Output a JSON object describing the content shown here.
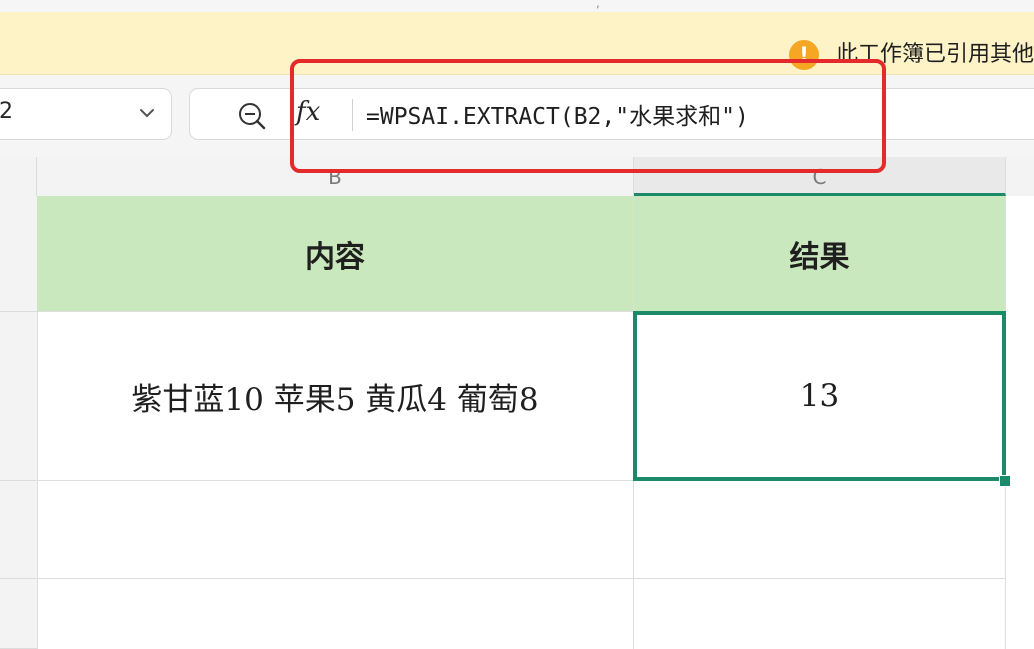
{
  "notice": {
    "icon": "warning-icon",
    "message": "此工作簿已引用其他"
  },
  "formula_bar": {
    "name_box": "2",
    "fx_label": "fx",
    "formula": "=WPSAI.EXTRACT(B2,\"水果求和\")"
  },
  "columns": [
    "B",
    "C"
  ],
  "table": {
    "headers": [
      "内容",
      "结果"
    ],
    "rows": [
      [
        "紫甘蓝10 苹果5 黄瓜4 葡萄8",
        "13"
      ]
    ]
  },
  "colors": {
    "header_fill": "#c9e8be",
    "selection": "#1a8a6b",
    "highlight_box": "#e42a2a",
    "notice_bg": "#fdf3c6"
  }
}
